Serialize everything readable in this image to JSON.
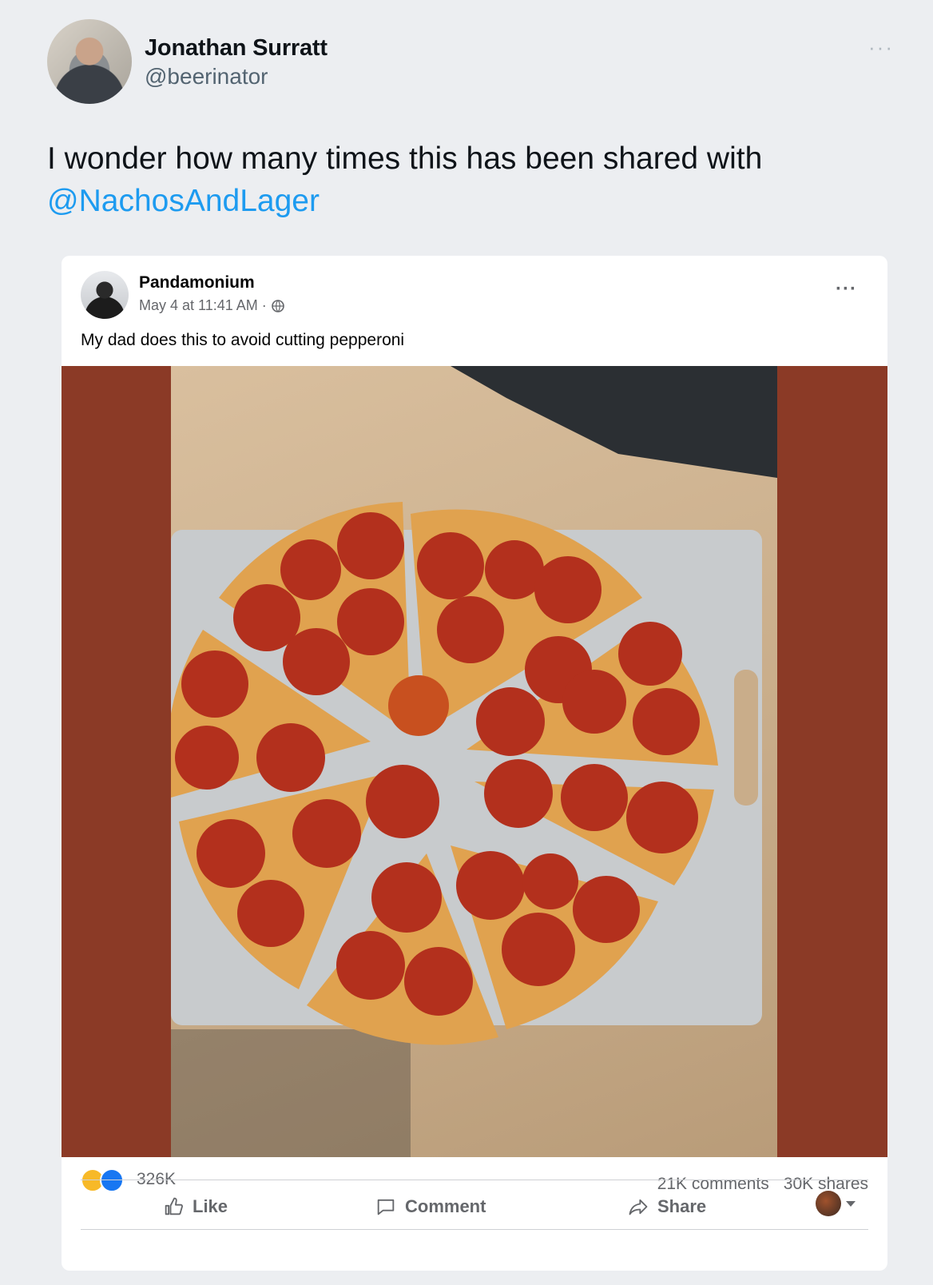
{
  "tweet": {
    "author_name": "Jonathan Surratt",
    "author_handle": "@beerinator",
    "more_icon": "more-horizontal-icon",
    "text": "I wonder how many times this has been shared with",
    "mention": "@NachosAndLager",
    "accent_color": "#1d9bf0"
  },
  "facebook_post": {
    "page_name": "Pandamonium",
    "timestamp": "May 4 at 11:41 AM ·",
    "privacy_icon": "globe-icon",
    "more_icon": "more-horizontal-icon",
    "caption": "My dad does this to avoid cutting pepperoni",
    "photo_description_icon": "pizza-photo",
    "reaction_icons": [
      "haha-icon",
      "like-icon"
    ],
    "reaction_count": "326K",
    "comments": "21K comments",
    "shares": "30K shares",
    "actions": {
      "like": "Like",
      "comment": "Comment",
      "share": "Share"
    },
    "photo_side_color": "#8b3a26",
    "brand_color": "#1877f2"
  }
}
